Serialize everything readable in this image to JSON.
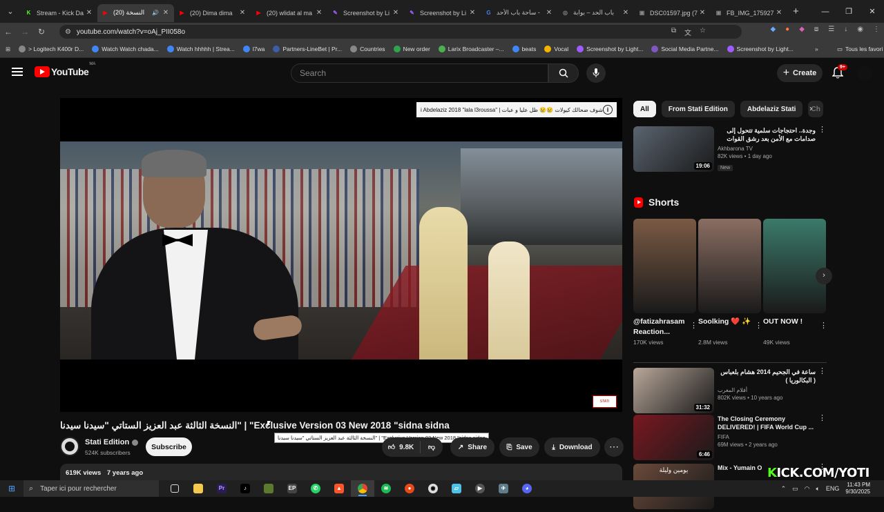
{
  "browser": {
    "tabs": [
      {
        "label": "Stream - Kick Da",
        "fav": "K",
        "color": "#53fc18",
        "active": false
      },
      {
        "label": "النسخة (20)",
        "fav": "▶",
        "color": "#ff0000",
        "active": true,
        "audio": "🔊"
      },
      {
        "label": "(20) Dima dima",
        "fav": "▶",
        "color": "#ff0000",
        "active": false
      },
      {
        "label": "(20) wlidat al ma",
        "fav": "▶",
        "color": "#ff0000",
        "active": false
      },
      {
        "label": "Screenshot by Li",
        "fav": "✎",
        "color": "#a05cff",
        "active": false
      },
      {
        "label": "Screenshot by Li",
        "fav": "✎",
        "color": "#a05cff",
        "active": false
      },
      {
        "label": "ساحة باب الأحد -",
        "fav": "G",
        "color": "#4285f4",
        "active": false
      },
      {
        "label": "باب الحد – بوابة",
        "fav": "◎",
        "color": "#888888",
        "active": false
      },
      {
        "label": "DSC01597.jpg (7",
        "fav": "▣",
        "color": "#888888",
        "active": false
      },
      {
        "label": "FB_IMG_175927",
        "fav": "▣",
        "color": "#888888",
        "active": false
      }
    ],
    "new_tab": "+",
    "url": "youtube.com/watch?v=oAj_PII058o",
    "bookmarks": [
      {
        "label": "> Logitech K400r D...",
        "color": "#888888"
      },
      {
        "label": "Watch Watch chada...",
        "color": "#4285f4"
      },
      {
        "label": "Watch hhhhh | Strea...",
        "color": "#4285f4"
      },
      {
        "label": "l7wa",
        "color": "#4285f4"
      },
      {
        "label": "Partners-LineBet | Pr...",
        "color": "#3a5fa8"
      },
      {
        "label": "Countries",
        "color": "#888888"
      },
      {
        "label": "New order",
        "color": "#2ea44f"
      },
      {
        "label": "Larix Broadcaster –...",
        "color": "#4caf50"
      },
      {
        "label": "beats",
        "color": "#4285f4"
      },
      {
        "label": "Vocal",
        "color": "#f4b400"
      },
      {
        "label": "Screenshot by Light...",
        "color": "#a05cff"
      },
      {
        "label": "Social Media Partne...",
        "color": "#7e57c2"
      },
      {
        "label": "Screenshot by Light...",
        "color": "#a05cff"
      }
    ],
    "bookmarks_more": "»",
    "bookmarks_folder": "Tous les favori"
  },
  "youtube": {
    "logo_text": "YouTube",
    "logo_region": "MA",
    "search_placeholder": "Search",
    "create_label": "Create",
    "notif_badge": "9+",
    "video": {
      "overlay_text": "i Abdelaziz 2018 \"lala l3roussa\" | شوف ضحالك كيولات 😢😢 ظل عليا و عبات",
      "title": "النسخة الثالثة عبد العزيز الستاتي \"سيدنا سيدنا\" | \"Exclusive Version 03 New 2018 \"sidna sidna",
      "tooltip": "النسخة الثالثة عبد العزيز الستاتي \"سيدنا سيدنا\" | \"Exclusive Version 03 New 2018 \"sidna sidna",
      "watermark": "STATI"
    },
    "channel": {
      "name": "Stati Edition",
      "subs": "524K subscribers",
      "subscribe_label": "Subscribe"
    },
    "actions": {
      "likes": "9.8K",
      "share": "Share",
      "save": "Save",
      "download": "Download",
      "more": "⋯"
    },
    "description": {
      "views": "619K views",
      "age": "7 years ago"
    },
    "chips": [
      "All",
      "From Stati Edition",
      "Abdelaziz Stati",
      "Ch"
    ],
    "recs_top": [
      {
        "title": "وجدة.. احتجاجات سلمية تتحول إلى صدامات مع الأمن بعد رشق القوات العمومية بالحجارة",
        "channel": "Akhbarona TV",
        "meta": "82K views • 1 day ago",
        "badge": "New",
        "duration": "19:06",
        "rtl": true,
        "tc": "#5a6470"
      }
    ],
    "shorts_title": "Shorts",
    "shorts": [
      {
        "label": "@fatizahrasam Reaction...",
        "views": "170K views",
        "tc": "#7a5a44"
      },
      {
        "label": "Soolking ❤️ ✨",
        "views": "2.8M views",
        "tc": "#8a6e62"
      },
      {
        "label": "OUT NOW !",
        "views": "49K views",
        "tc": "#3b7a6a"
      }
    ],
    "recs_bottom": [
      {
        "title": "ساعة في الجحيم 2014 هشام بلعباس ( البكالوريا )",
        "channel": "أفلام المغرب",
        "meta": "802K views • 10 years ago",
        "duration": "31:32",
        "rtl": true,
        "tc": "#b9a89a"
      },
      {
        "title": "The Closing Ceremony DELIVERED! | FIFA World Cup ...",
        "channel": "FIFA",
        "meta": "69M views • 2 years ago",
        "duration": "6:46",
        "rtl": false,
        "tc": "#7a1820"
      },
      {
        "title": "Mix - Yumain O",
        "channel": "",
        "meta": "",
        "duration": "",
        "rtl": false,
        "tc": "#6a4a3a"
      }
    ],
    "rec3_thumb_text": "يومين وليلة"
  },
  "taskbar": {
    "search_placeholder": "Taper ici pour rechercher",
    "lang": "ENG",
    "time": "11:43 PM",
    "date": "9/30/2025"
  },
  "stream_watermark": {
    "prefix": "K",
    "rest": "ICK.COM/YOTI"
  }
}
